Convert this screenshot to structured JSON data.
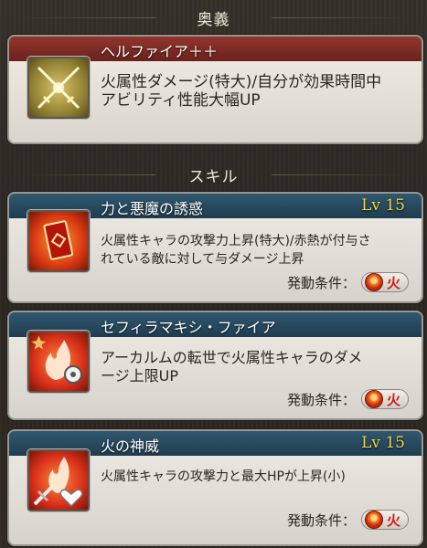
{
  "ougi_section": {
    "title": "奥義"
  },
  "ougi": {
    "name": "ヘルファイア＋＋",
    "desc_lines": [
      "火属性ダメージ(特大)/自分が効果時間中",
      "アビリティ性能大幅UP"
    ],
    "icon": "crossed-swords-icon"
  },
  "skill_section": {
    "title": "スキル"
  },
  "skills": [
    {
      "name": "力と悪魔の誘惑",
      "level": "Lv 15",
      "desc_lines": [
        "火属性キャラの攻撃力上昇(特大)/赤熱が付与さ",
        "れている敵に対して与ダメージ上昇"
      ],
      "condition_label": "発動条件：",
      "element": "火",
      "icon": "devil-card-icon"
    },
    {
      "name": "セフィラマキシ・ファイア",
      "level": "",
      "desc_lines": [
        "アーカルムの転世で火属性キャラのダメ",
        "ージ上限UP"
      ],
      "condition_label": "発動条件：",
      "element": "火",
      "icon": "fire-gear-icon"
    },
    {
      "name": "火の神威",
      "level": "Lv 15",
      "desc_lines": [
        "火属性キャラの攻撃力と最大HPが上昇(小)"
      ],
      "condition_label": "発動条件：",
      "element": "火",
      "icon": "fire-sword-heart-icon"
    }
  ],
  "colors": {
    "ougi_title_bar": "#7e2a24",
    "skill_title_bar": "#284a5e",
    "level_text": "#f5d53a",
    "fire_element": "#c8220e"
  }
}
